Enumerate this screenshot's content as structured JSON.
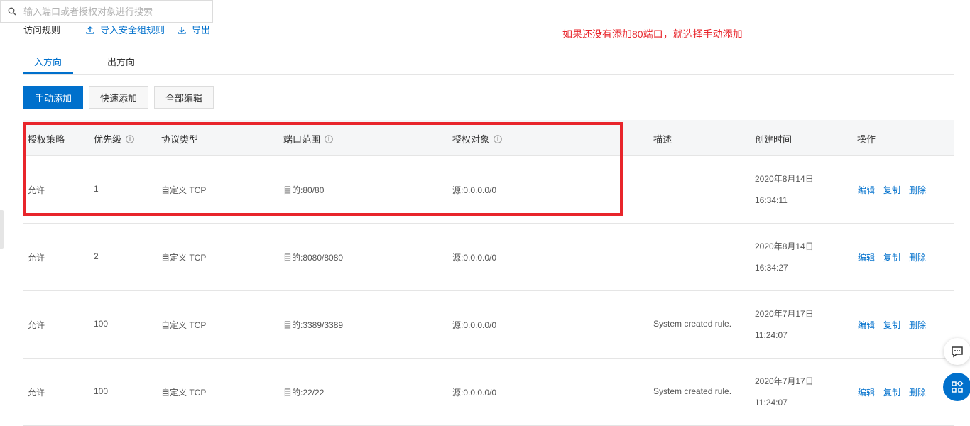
{
  "header": {
    "title": "访问规则",
    "import_label": "导入安全组规则",
    "export_label": "导出",
    "annotation": "如果还没有添加80端口，就选择手动添加"
  },
  "tabs": [
    {
      "label": "入方向",
      "active": true
    },
    {
      "label": "出方向",
      "active": false
    }
  ],
  "toolbar": {
    "manual_add": "手动添加",
    "quick_add": "快速添加",
    "edit_all": "全部编辑",
    "search_placeholder": "输入端口或者授权对象进行搜索"
  },
  "table": {
    "headers": {
      "policy": "授权策略",
      "priority": "优先级",
      "protocol": "协议类型",
      "port_range": "端口范围",
      "auth_object": "授权对象",
      "description": "描述",
      "created": "创建时间",
      "actions": "操作"
    },
    "rows": [
      {
        "policy": "允许",
        "priority": "1",
        "protocol": "自定义 TCP",
        "port": "目的:80/80",
        "source": "源:0.0.0.0/0",
        "description": "",
        "date": "2020年8月14日",
        "time": "16:34:11"
      },
      {
        "policy": "允许",
        "priority": "2",
        "protocol": "自定义 TCP",
        "port": "目的:8080/8080",
        "source": "源:0.0.0.0/0",
        "description": "",
        "date": "2020年8月14日",
        "time": "16:34:27"
      },
      {
        "policy": "允许",
        "priority": "100",
        "protocol": "自定义 TCP",
        "port": "目的:3389/3389",
        "source": "源:0.0.0.0/0",
        "description": "System created rule.",
        "date": "2020年7月17日",
        "time": "11:24:07"
      },
      {
        "policy": "允许",
        "priority": "100",
        "protocol": "自定义 TCP",
        "port": "目的:22/22",
        "source": "源:0.0.0.0/0",
        "description": "System created rule.",
        "date": "2020年7月17日",
        "time": "11:24:07"
      }
    ],
    "actions": {
      "edit": "编辑",
      "copy": "复制",
      "delete": "删除"
    }
  },
  "colors": {
    "accent": "#0070cc",
    "annotation": "#e8252b"
  },
  "icons": [
    "upload-icon",
    "download-icon",
    "search-icon",
    "info-icon",
    "chat-icon",
    "apps-icon"
  ]
}
